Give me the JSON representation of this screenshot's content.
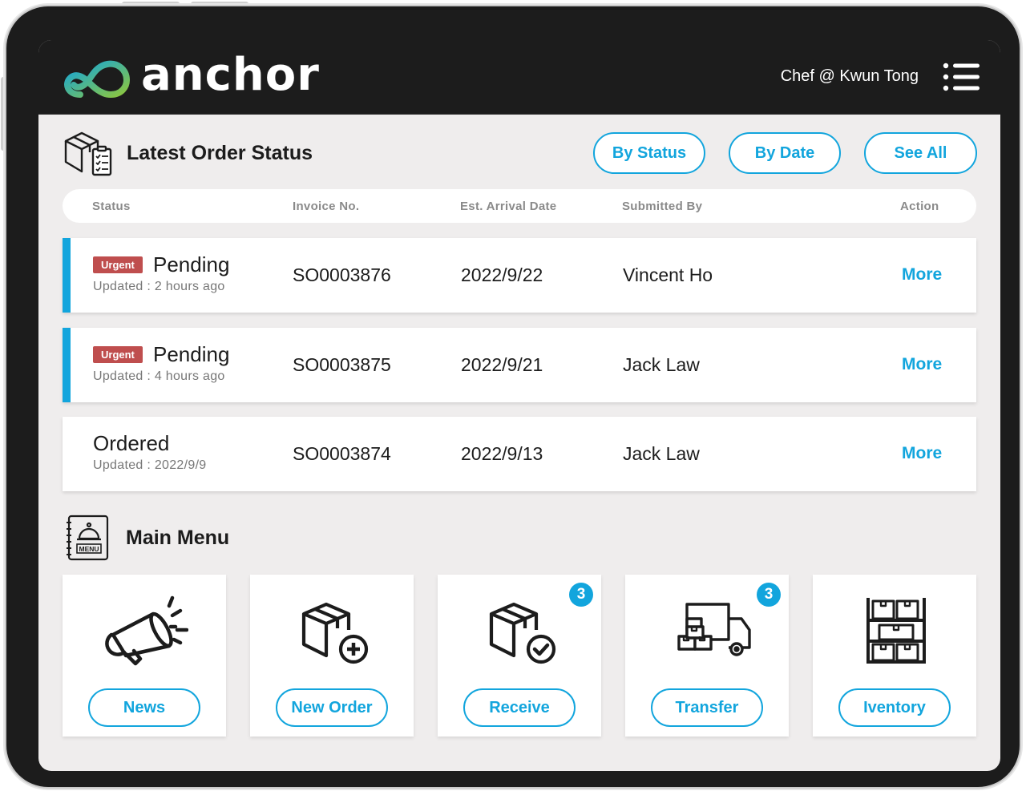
{
  "app": {
    "logo_text": "anchor",
    "user_label": "Chef @ Kwun Tong"
  },
  "orders": {
    "title": "Latest Order Status",
    "filters": {
      "by_status": "By Status",
      "by_date": "By Date",
      "see_all": "See All"
    },
    "columns": [
      "Status",
      "Invoice No.",
      "Est. Arrival Date",
      "Submitted By",
      "Action"
    ],
    "rows": [
      {
        "badge": "Urgent",
        "status": "Pending",
        "updated": "Updated : 2 hours ago",
        "invoice": "SO0003876",
        "arrival": "2022/9/22",
        "submitted_by": "Vincent Ho",
        "action": "More"
      },
      {
        "badge": "Urgent",
        "status": "Pending",
        "updated": "Updated : 4 hours ago",
        "invoice": "SO0003875",
        "arrival": "2022/9/21",
        "submitted_by": "Jack Law",
        "action": "More"
      },
      {
        "badge": "",
        "status": "Ordered",
        "updated": "Updated : 2022/9/9",
        "invoice": "SO0003874",
        "arrival": "2022/9/13",
        "submitted_by": "Jack Law",
        "action": "More"
      }
    ]
  },
  "menu": {
    "title": "Main Menu",
    "icon_text": "MENU",
    "items": [
      {
        "label": "News",
        "icon": "megaphone-icon",
        "badge": ""
      },
      {
        "label": "New Order",
        "icon": "box-plus-icon",
        "badge": ""
      },
      {
        "label": "Receive",
        "icon": "box-check-icon",
        "badge": "3"
      },
      {
        "label": "Transfer",
        "icon": "truck-icon",
        "badge": "3"
      },
      {
        "label": "Iventory",
        "icon": "shelves-icon",
        "badge": ""
      }
    ]
  },
  "colors": {
    "accent": "#12a5dd",
    "urgent": "#bf4e4e",
    "frame": "#1c1c1c",
    "background": "#efeded"
  }
}
